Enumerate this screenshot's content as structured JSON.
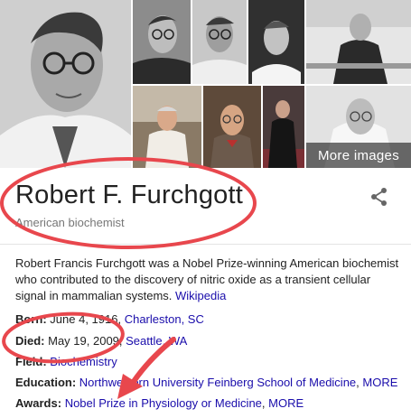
{
  "images": {
    "more_images_label": "More images"
  },
  "header": {
    "title": "Robert F. Furchgott",
    "subtitle": "American biochemist",
    "share_icon": "share-icon"
  },
  "description": {
    "text": "Robert Francis Furchgott was a Nobel Prize-winning American biochemist who contributed to the discovery of nitric oxide as a transient cellular signal in mammalian systems. ",
    "source_link": "Wikipedia"
  },
  "facts": {
    "born": {
      "label": "Born:",
      "date": "June 4, 1916, ",
      "place": "Charleston, SC"
    },
    "died": {
      "label": "Died:",
      "date": "May 19, 2009, ",
      "place": "Seattle, WA"
    },
    "field": {
      "label": "Field:",
      "value": "Biochemistry"
    },
    "education": {
      "label": "Education:",
      "value": "Northwestern University Feinberg School of Medicine",
      "sep": ", ",
      "more": "MORE"
    },
    "awards": {
      "label": "Awards:",
      "value": "Nobel Prize in Physiology or Medicine",
      "sep": ", ",
      "more": "MORE"
    }
  },
  "annotation_color": "#e8474d"
}
